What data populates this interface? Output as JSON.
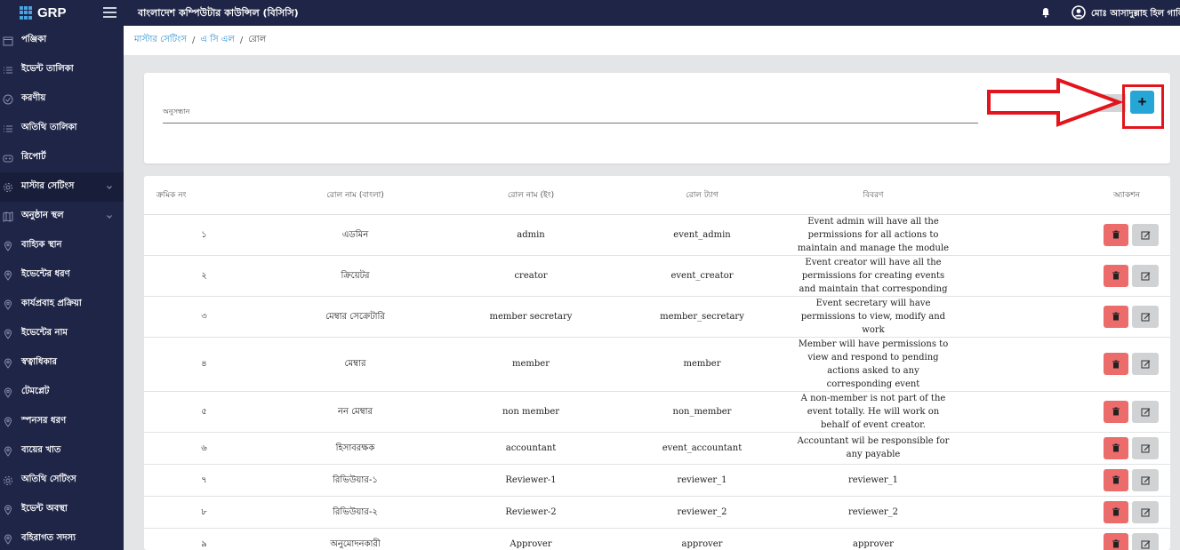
{
  "app": {
    "logo_text": "GRP",
    "title": "বাংলাদেশ কম্পিউটার কাউন্সিল (বিসিসি)",
    "user_name": "মোঃ আসাদুল্লাহ হিল গালিব"
  },
  "sidebar": {
    "items": [
      {
        "label": "পঞ্জিকা",
        "icon": "calendar-icon"
      },
      {
        "label": "ইভেন্ট তালিকা",
        "icon": "list-icon"
      },
      {
        "label": "করণীয়",
        "icon": "check-circle-icon"
      },
      {
        "label": "অতিথি তালিকা",
        "icon": "list-icon"
      },
      {
        "label": "রিপোর্ট",
        "icon": "report-icon"
      },
      {
        "label": "মাস্টার সেটিংস",
        "icon": "gear-icon"
      },
      {
        "label": "অনুষ্ঠান স্থল",
        "icon": "map-icon"
      },
      {
        "label": "বাহ্যিক স্থান",
        "icon": "location-icon"
      },
      {
        "label": "ইভেন্টের ধরণ",
        "icon": "location-icon"
      },
      {
        "label": "কার্যপ্রবাহ প্রক্রিয়া",
        "icon": "location-icon"
      },
      {
        "label": "ইভেন্টের নাম",
        "icon": "location-icon"
      },
      {
        "label": "স্বত্বাধিকার",
        "icon": "location-icon"
      },
      {
        "label": "টেমপ্লেট",
        "icon": "location-icon"
      },
      {
        "label": "স্পনসর ধরণ",
        "icon": "location-icon"
      },
      {
        "label": "ব্যয়ের খাত",
        "icon": "location-icon"
      },
      {
        "label": "অতিথি সেটিংস",
        "icon": "gear-icon"
      },
      {
        "label": "ইভেন্ট অবস্থা",
        "icon": "location-icon"
      },
      {
        "label": "বহিরাগত সদস্য",
        "icon": "location-icon"
      }
    ]
  },
  "breadcrumb": {
    "level1": "মাস্টার সেটিংস",
    "level2": "এ সি এল",
    "current": "রোল",
    "separator": "/"
  },
  "search": {
    "label": "অনুসন্ধান",
    "value": "",
    "add_label": "+"
  },
  "table": {
    "headers": {
      "serial": "ক্রমিক নং",
      "name_bn": "রোল নাম (বাংলা)",
      "name_en": "রোল নাম (ইং)",
      "tag": "রোল ট্যাগ",
      "description": "বিবরণ",
      "action": "অ্যাকশন"
    },
    "rows": [
      {
        "serial": "১",
        "name_bn": "এডমিন",
        "name_en": "admin",
        "tag": "event_admin",
        "description": "Event admin will have all the permissions for all actions to maintain and manage the module"
      },
      {
        "serial": "২",
        "name_bn": "ক্রিয়েটর",
        "name_en": "creator",
        "tag": "event_creator",
        "description": "Event creator will have all the permissions for creating events and maintain that corresponding"
      },
      {
        "serial": "৩",
        "name_bn": "মেম্বার সেক্রেটারি",
        "name_en": "member secretary",
        "tag": "member_secretary",
        "description": "Event secretary will have permissions to view, modify and work"
      },
      {
        "serial": "৪",
        "name_bn": "মেম্বার",
        "name_en": "member",
        "tag": "member",
        "description": "Member will have permissions to view and respond to pending actions asked to any corresponding event"
      },
      {
        "serial": "৫",
        "name_bn": "নন মেম্বার",
        "name_en": "non member",
        "tag": "non_member",
        "description": "A non-member is not part of the event totally. He will work on behalf of event creator."
      },
      {
        "serial": "৬",
        "name_bn": "হিসাবরক্ষক",
        "name_en": "accountant",
        "tag": "event_accountant",
        "description": "Accountant wil be responsible for any payable"
      },
      {
        "serial": "৭",
        "name_bn": "রিভিউয়ার-১",
        "name_en": "Reviewer-1",
        "tag": "reviewer_1",
        "description": "reviewer_1"
      },
      {
        "serial": "৮",
        "name_bn": "রিভিউয়ার-২",
        "name_en": "Reviewer-2",
        "tag": "reviewer_2",
        "description": "reviewer_2"
      },
      {
        "serial": "৯",
        "name_bn": "অনুমোদনকারী",
        "name_en": "Approver",
        "tag": "approver",
        "description": "approver"
      }
    ]
  },
  "colors": {
    "sidebar_bg": "#1f2547",
    "add_button": "#26a6d6",
    "delete_button": "#ec6b6b",
    "edit_button": "#d0d2d4",
    "annotation_red": "#e3141c"
  }
}
